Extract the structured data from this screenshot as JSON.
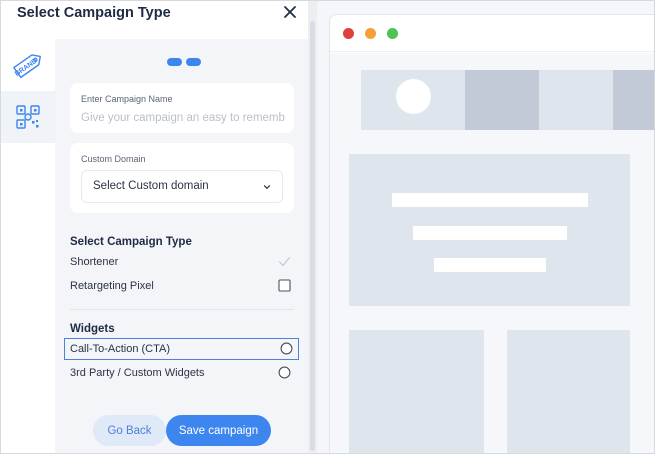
{
  "panel": {
    "title": "Select Campaign Type"
  },
  "rail": {
    "items": [
      {
        "name": "brand-tag-icon"
      },
      {
        "name": "qr-code-icon"
      }
    ]
  },
  "name_card": {
    "label": "Enter Campaign Name",
    "placeholder": "Give your campaign an easy to remember"
  },
  "domain_card": {
    "label": "Custom Domain",
    "selected": "Select Custom domain"
  },
  "campaign_type": {
    "heading": "Select Campaign Type",
    "options": [
      {
        "label": "Shortener",
        "state": "checked"
      },
      {
        "label": "Retargeting Pixel",
        "state": "unchecked"
      }
    ]
  },
  "widgets": {
    "heading": "Widgets",
    "options": [
      {
        "label": "Call-To-Action (CTA)",
        "state": "focused"
      },
      {
        "label": "3rd Party / Custom Widgets",
        "state": "unselected"
      }
    ]
  },
  "buttons": {
    "back": "Go Back",
    "save": "Save campaign"
  },
  "colors": {
    "accent": "#3d86f0",
    "focus_border": "#4a82dd",
    "traffic_red": "#e0403a",
    "traffic_yellow": "#f2a134",
    "traffic_green": "#4cc451"
  }
}
